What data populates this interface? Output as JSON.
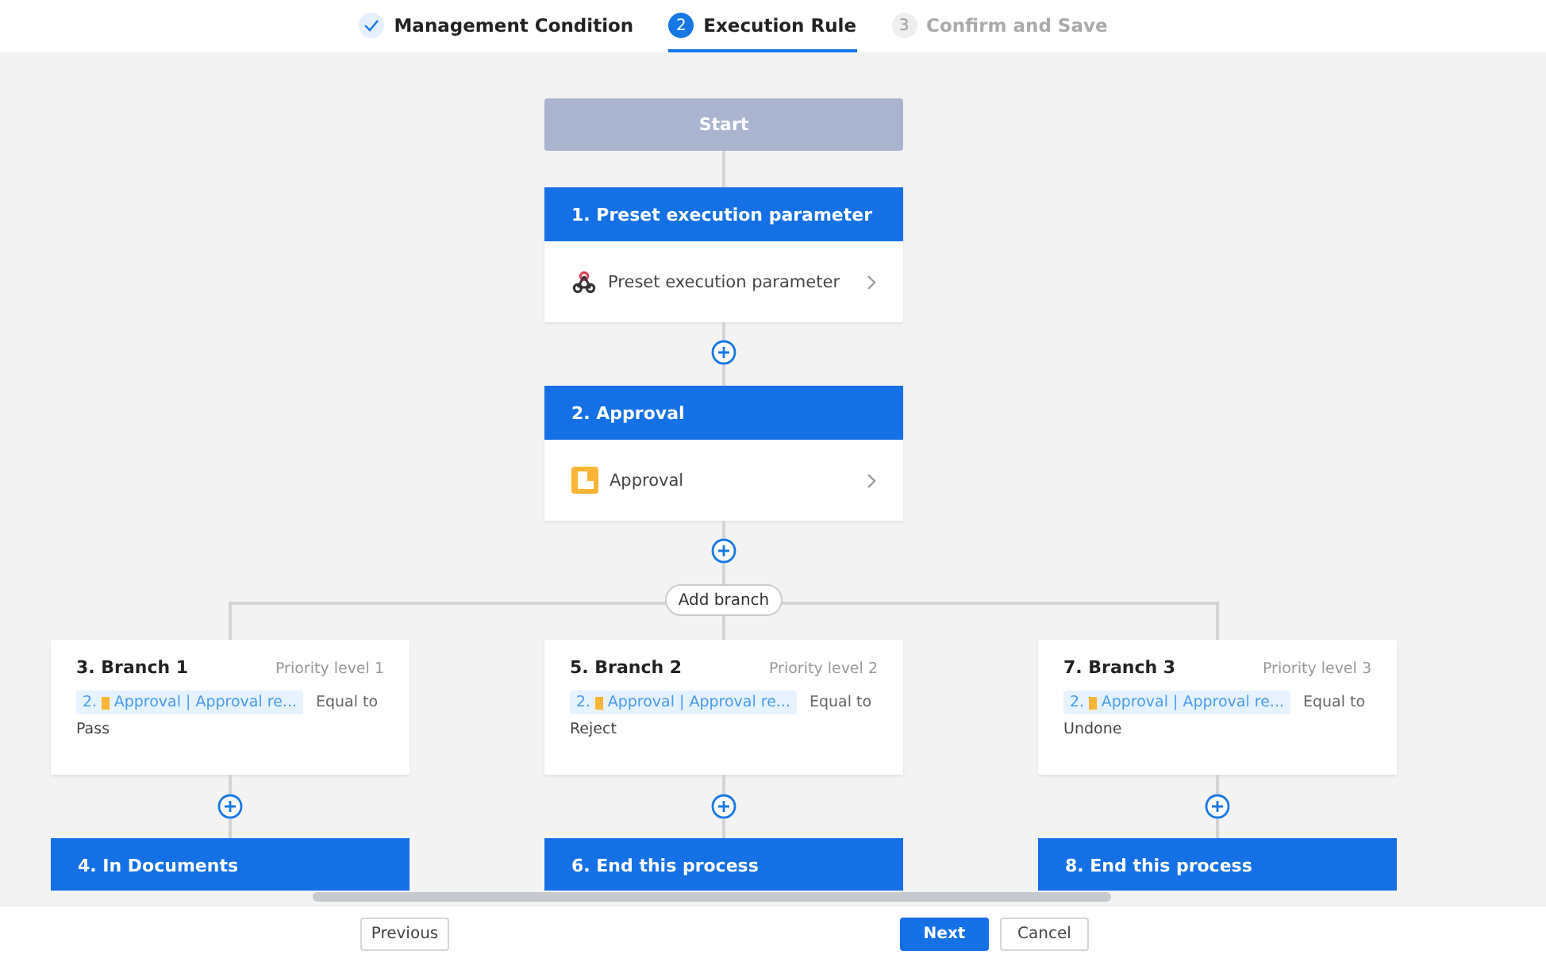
{
  "steps": [
    {
      "label": "Management Condition",
      "completed": true,
      "selected": false
    },
    {
      "number": "2",
      "label": "Execution Rule",
      "completed": false,
      "selected": true
    },
    {
      "number": "3",
      "label": "Confirm and Save",
      "completed": false,
      "selected": false
    }
  ],
  "flow": {
    "start": "Start",
    "nodes": [
      {
        "title": "1. Preset execution parameter",
        "item": "Preset execution parameter",
        "kind": "webhook"
      },
      {
        "title": "2. Approval",
        "item": "Approval",
        "kind": "approval"
      }
    ],
    "add_branch": "Add branch",
    "branches": [
      {
        "title": "3. Branch 1",
        "priority": "Priority level 1",
        "tag_index": "2.",
        "tag_text": "Approval | Approval re...",
        "operator": "Equal to",
        "value": "Pass",
        "end_node": "4. In Documents"
      },
      {
        "title": "5. Branch 2",
        "priority": "Priority level 2",
        "tag_index": "2.",
        "tag_text": "Approval | Approval re...",
        "operator": "Equal to",
        "value": "Reject",
        "end_node": "6. End this process"
      },
      {
        "title": "7. Branch 3",
        "priority": "Priority level 3",
        "tag_index": "2.",
        "tag_text": "Approval | Approval re...",
        "operator": "Equal to",
        "value": "Undone",
        "end_node": "8. End this process"
      }
    ]
  },
  "footer": {
    "buttons": [
      {
        "label": "Previous",
        "kind": "default"
      },
      {
        "label": "Next",
        "kind": "primary"
      },
      {
        "label": "Cancel",
        "kind": "default"
      }
    ]
  }
}
